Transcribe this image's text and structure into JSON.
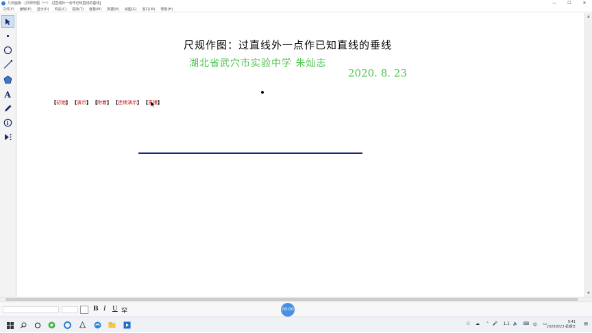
{
  "window": {
    "title": "几何画板 - [尺规作图（一）：过直线外一点作已知直线的垂线]",
    "controls": [
      "—",
      "☐",
      "✕"
    ]
  },
  "menu": [
    "文件(F)",
    "编辑(E)",
    "显示(D)",
    "构造(C)",
    "变换(T)",
    "度量(M)",
    "数据(N)",
    "绘图(G)",
    "窗口(W)",
    "帮助(H)"
  ],
  "tools": [
    "selection-arrow-icon",
    "point-tool-icon",
    "compass-circle-icon",
    "straightedge-icon",
    "polygon-icon",
    "text-tool-icon",
    "marker-pen-icon",
    "information-icon",
    "custom-tool-icon"
  ],
  "canvas": {
    "heading": "尺规作图：过直线外一点作已知直线的垂线",
    "author": "湖北省武穴市实验中学   朱灿志",
    "date": "2020. 8. 23",
    "action_buttons": [
      "初始",
      "演示",
      "附着",
      "连续演示",
      "重播"
    ]
  },
  "textbar": {
    "bold": "B",
    "italic": "I",
    "underline": "U",
    "special": "罕",
    "timer": "00:00"
  },
  "taskbar": {
    "input_method": "1,1",
    "lang": "中",
    "time": "9:41",
    "date": "2020/8/23 星期日"
  },
  "colors": {
    "heading": "#000000",
    "author": "#4ec44e",
    "button_text": "#d01010",
    "line": "#1a2a7a",
    "timer": "#4a90e2"
  }
}
